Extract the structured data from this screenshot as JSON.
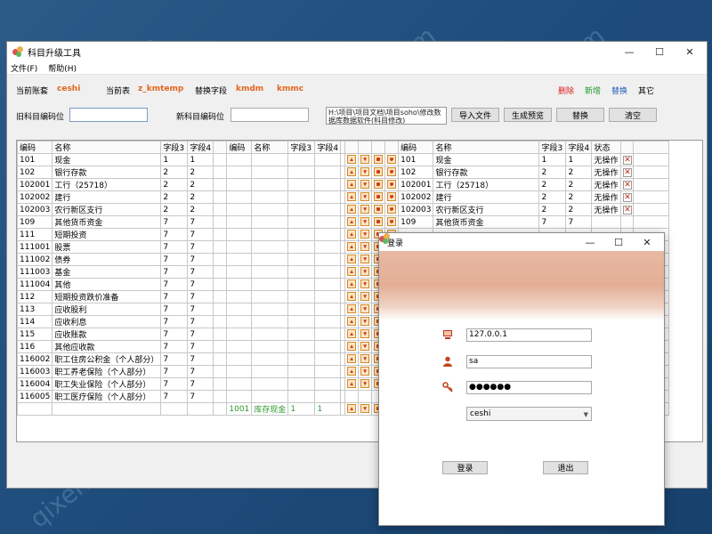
{
  "main": {
    "title": "科目升级工具",
    "menu": [
      "文件(F)",
      "帮助(H)"
    ],
    "window_controls": {
      "minimize": "—",
      "maximize": "☐",
      "close": "✕"
    },
    "info": {
      "current_account_label": "当前账套",
      "current_account_value": "ceshi",
      "current_table_label": "当前表",
      "current_table_value": "z_kmtemp",
      "replace_field_label": "替换字段",
      "replace_field_value1": "kmdm",
      "replace_field_value2": "kmmc",
      "legend_delete": "删除",
      "legend_add": "新增",
      "legend_replace": "替换",
      "legend_other": "其它"
    },
    "legend_colors": {
      "delete": "#e02020",
      "add": "#1f9a2a",
      "replace": "#1f5fbf",
      "other": "#000000"
    },
    "old_code_label": "旧科目编码位",
    "new_code_label": "新科目编码位",
    "path_text": "H:\\项目\\项目文档\\项目soho\\修改数据库数据软件(科目修改)",
    "buttons": {
      "import": "导入文件",
      "preview": "生成预览",
      "replace": "替换",
      "clear": "清空"
    }
  },
  "grid": {
    "left_headers": [
      "编码",
      "名称",
      "字段3",
      "字段4"
    ],
    "mid_headers": [
      "编码",
      "名称",
      "字段3",
      "字段4"
    ],
    "right_headers": [
      "编码",
      "名称",
      "字段3",
      "字段4",
      "状态"
    ],
    "left_rows": [
      [
        "101",
        "现金",
        "1",
        "1"
      ],
      [
        "102",
        "银行存款",
        "2",
        "2"
      ],
      [
        "102001",
        "工行（25718）",
        "2",
        "2"
      ],
      [
        "102002",
        "建行",
        "2",
        "2"
      ],
      [
        "102003",
        "农行新区支行",
        "2",
        "2"
      ],
      [
        "109",
        "其他货币资金",
        "7",
        "7"
      ],
      [
        "111",
        "短期投资",
        "7",
        "7"
      ],
      [
        "111001",
        "股票",
        "7",
        "7"
      ],
      [
        "111002",
        "债券",
        "7",
        "7"
      ],
      [
        "111003",
        "基金",
        "7",
        "7"
      ],
      [
        "111004",
        "其他",
        "7",
        "7"
      ],
      [
        "112",
        "短期投资跌价准备",
        "7",
        "7"
      ],
      [
        "113",
        "应收股利",
        "7",
        "7"
      ],
      [
        "114",
        "应收利息",
        "7",
        "7"
      ],
      [
        "115",
        "应收账款",
        "7",
        "7"
      ],
      [
        "116",
        "其他应收款",
        "7",
        "7"
      ],
      [
        "116002",
        "职工住房公积金（个人部分）",
        "7",
        "7"
      ],
      [
        "116003",
        "职工养老保险（个人部分）",
        "7",
        "7"
      ],
      [
        "116004",
        "职工失业保险（个人部分）",
        "7",
        "7"
      ],
      [
        "116005",
        "职工医疗保险（个人部分）",
        "7",
        "7"
      ]
    ],
    "mid_last_row": [
      "1001",
      "库存现金",
      "1",
      "1"
    ],
    "right_rows": [
      [
        "101",
        "现金",
        "1",
        "1",
        "无操作"
      ],
      [
        "102",
        "银行存款",
        "2",
        "2",
        "无操作"
      ],
      [
        "102001",
        "工行（25718）",
        "2",
        "2",
        "无操作"
      ],
      [
        "102002",
        "建行",
        "2",
        "2",
        "无操作"
      ],
      [
        "102003",
        "农行新区支行",
        "2",
        "2",
        "无操作"
      ],
      [
        "109",
        "其他货币资金",
        "7",
        "7",
        ""
      ]
    ]
  },
  "login": {
    "title": "登录",
    "server": "127.0.0.1",
    "user": "sa",
    "password": "●●●●●●",
    "database": "ceshi",
    "login_button": "登录",
    "exit_button": "退出"
  },
  "watermark": "qixeng.com"
}
